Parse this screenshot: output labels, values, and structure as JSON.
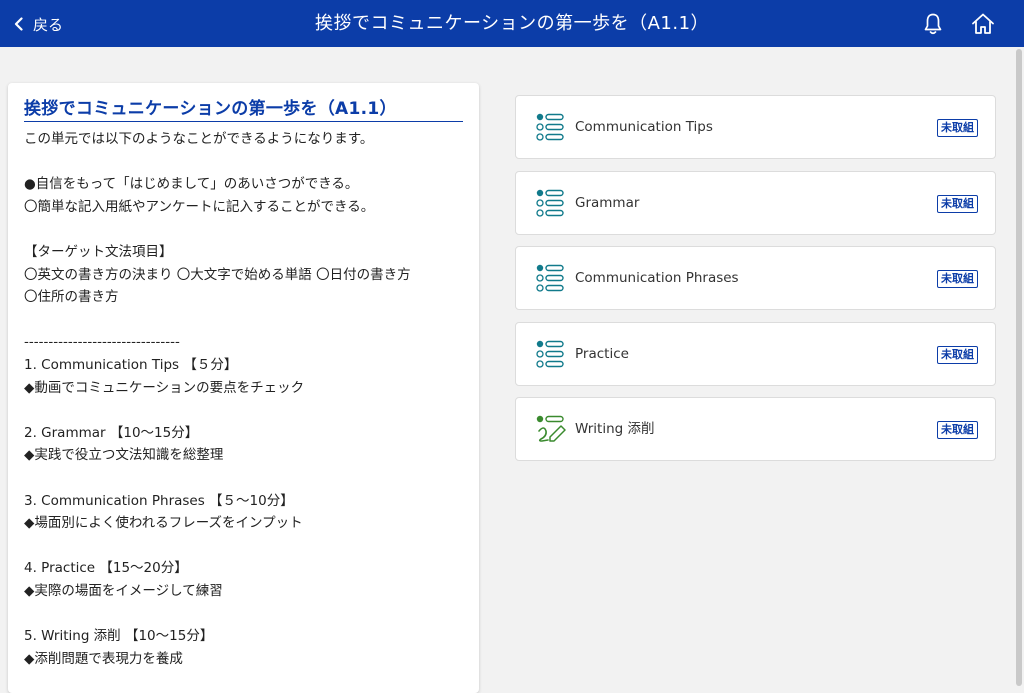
{
  "header": {
    "back_label": "戻る",
    "title": "挨拶でコミュニケーションの第一歩を（A1.1）",
    "bg_color": "#0c3da8"
  },
  "lesson": {
    "title": "挨拶でコミュニケーションの第一歩を（A1.1）",
    "lines": [
      "この単元では以下のようなことができるようになります。",
      "",
      "●自信をもって「はじめまして」のあいさつができる。",
      "〇簡単な記入用紙やアンケートに記入することができる。",
      "",
      "【ターゲット文法項目】",
      "〇英文の書き方の決まり 〇大文字で始める単語 〇日付の書き方",
      "〇住所の書き方",
      "",
      "--------------------------------",
      "1. Communication Tips 【５分】",
      "◆動画でコミュニケーションの要点をチェック",
      "",
      "2. Grammar 【10～15分】",
      "◆実践で役立つ文法知識を総整理",
      "",
      "3. Communication Phrases 【５～10分】",
      "◆場面別によく使われるフレーズをインプット",
      "",
      "4. Practice 【15～20分】",
      "◆実際の場面をイメージして練習",
      "",
      "5. Writing 添削 【10～15分】",
      "◆添削問題で表現力を養成"
    ]
  },
  "sections": [
    {
      "label": "Communication Tips",
      "status": "未取組",
      "icon": "list-icon"
    },
    {
      "label": "Grammar",
      "status": "未取組",
      "icon": "list-icon"
    },
    {
      "label": "Communication Phrases",
      "status": "未取組",
      "icon": "list-icon"
    },
    {
      "label": "Practice",
      "status": "未取組",
      "icon": "list-icon"
    },
    {
      "label": "Writing 添削",
      "status": "未取組",
      "icon": "pen-icon"
    }
  ]
}
